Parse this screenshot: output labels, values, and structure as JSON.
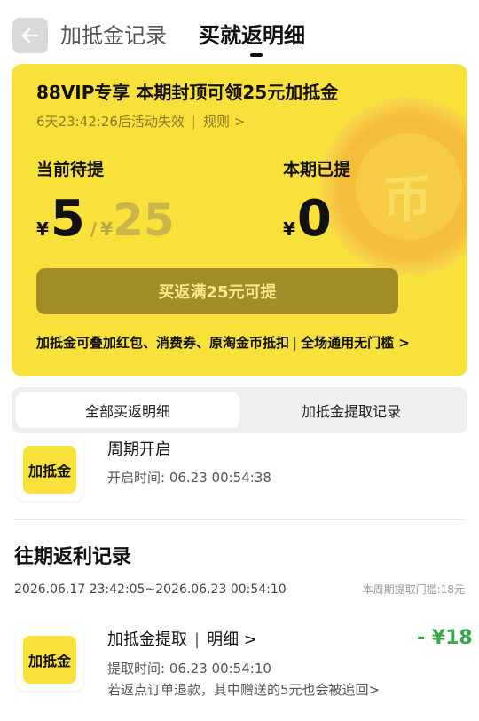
{
  "header": {
    "back_icon": "arrow-left-icon",
    "tab_records": "加抵金记录",
    "tab_details": "买就返明细"
  },
  "card": {
    "title": "88VIP专享 本期封顶可领25元加抵金",
    "countdown": "6天23:42:26后活动失效",
    "rules_link": "规则 >",
    "pending_label": "当前待提",
    "claimed_label": "本期已提",
    "currency": "¥",
    "pending_amount": "5",
    "pending_cap": "25",
    "claimed_amount": "0",
    "claim_button": "买返满25元可提",
    "footer_left": "加抵金可叠加红包、消费券、原淘金币抵扣",
    "footer_right": "全场通用无门槛 >",
    "accent_color": "#f9e13c"
  },
  "segments": {
    "active": "全部买返明细",
    "inactive": "加抵金提取记录"
  },
  "current_row": {
    "icon_label": "加抵金",
    "title": "周期开启",
    "meta": "开启时间:  06.23 00:54:38"
  },
  "history": {
    "section_title": "往期返利记录",
    "range": "2026.06.17 23:42:05~2026.06.23 00:54:10",
    "threshold": "本周期提取门槛:18元",
    "row": {
      "icon_label": "加抵金",
      "title": "加抵金提取",
      "detail_link": "明细 >",
      "amount": "- ¥18",
      "time": "提取时间:  06.23 00:54:10",
      "note": "若返点订单退款，其中赠送的5元也会被追回>"
    }
  }
}
